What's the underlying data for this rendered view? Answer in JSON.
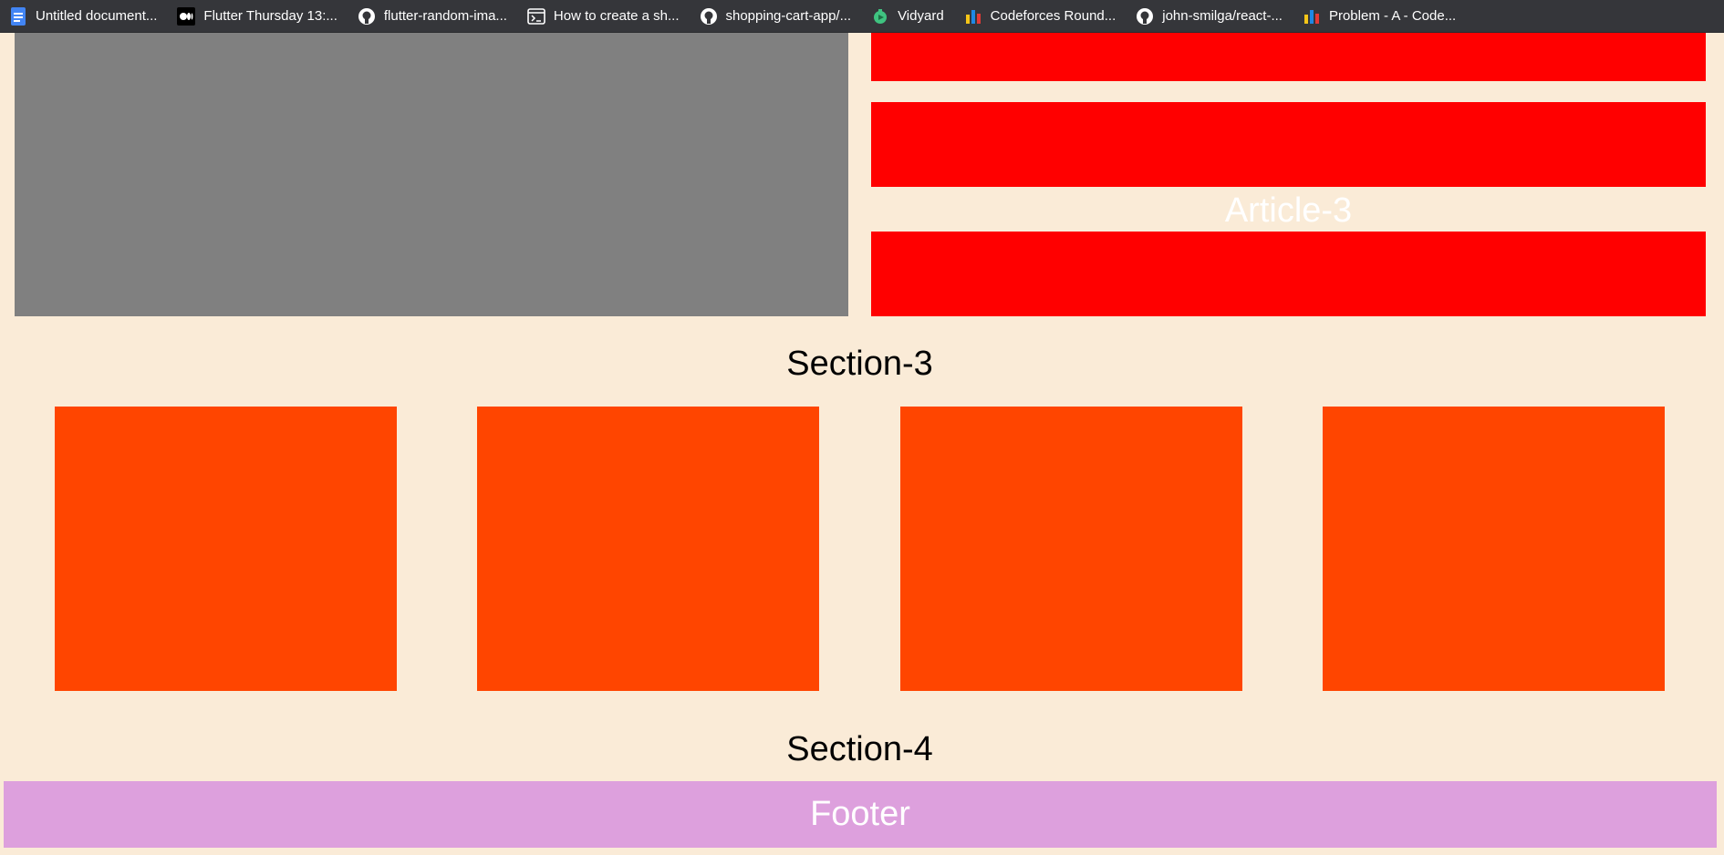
{
  "bookmarks_bar": {
    "items": [
      {
        "label": "Untitled document...",
        "icon": "google-docs-icon"
      },
      {
        "label": "Flutter Thursday 13:...",
        "icon": "medium-icon"
      },
      {
        "label": "flutter-random-ima...",
        "icon": "github-icon"
      },
      {
        "label": "How to create a sh...",
        "icon": "terminal-page-icon"
      },
      {
        "label": "shopping-cart-app/...",
        "icon": "github-icon"
      },
      {
        "label": "Vidyard",
        "icon": "vidyard-icon"
      },
      {
        "label": "Codeforces Round...",
        "icon": "codeforces-icon"
      },
      {
        "label": "john-smilga/react-...",
        "icon": "github-icon"
      },
      {
        "label": "Problem - A - Code...",
        "icon": "codeforces-icon"
      }
    ]
  },
  "page": {
    "article_label": "Article-3",
    "section3_title": "Section-3",
    "section4_title": "Section-4",
    "footer_text": "Footer"
  },
  "colors": {
    "page_background": "#faebd7",
    "gray_block": "#808080",
    "red_block": "#ff0000",
    "orange_block": "#ff4500",
    "footer_background": "#dda0dd"
  }
}
